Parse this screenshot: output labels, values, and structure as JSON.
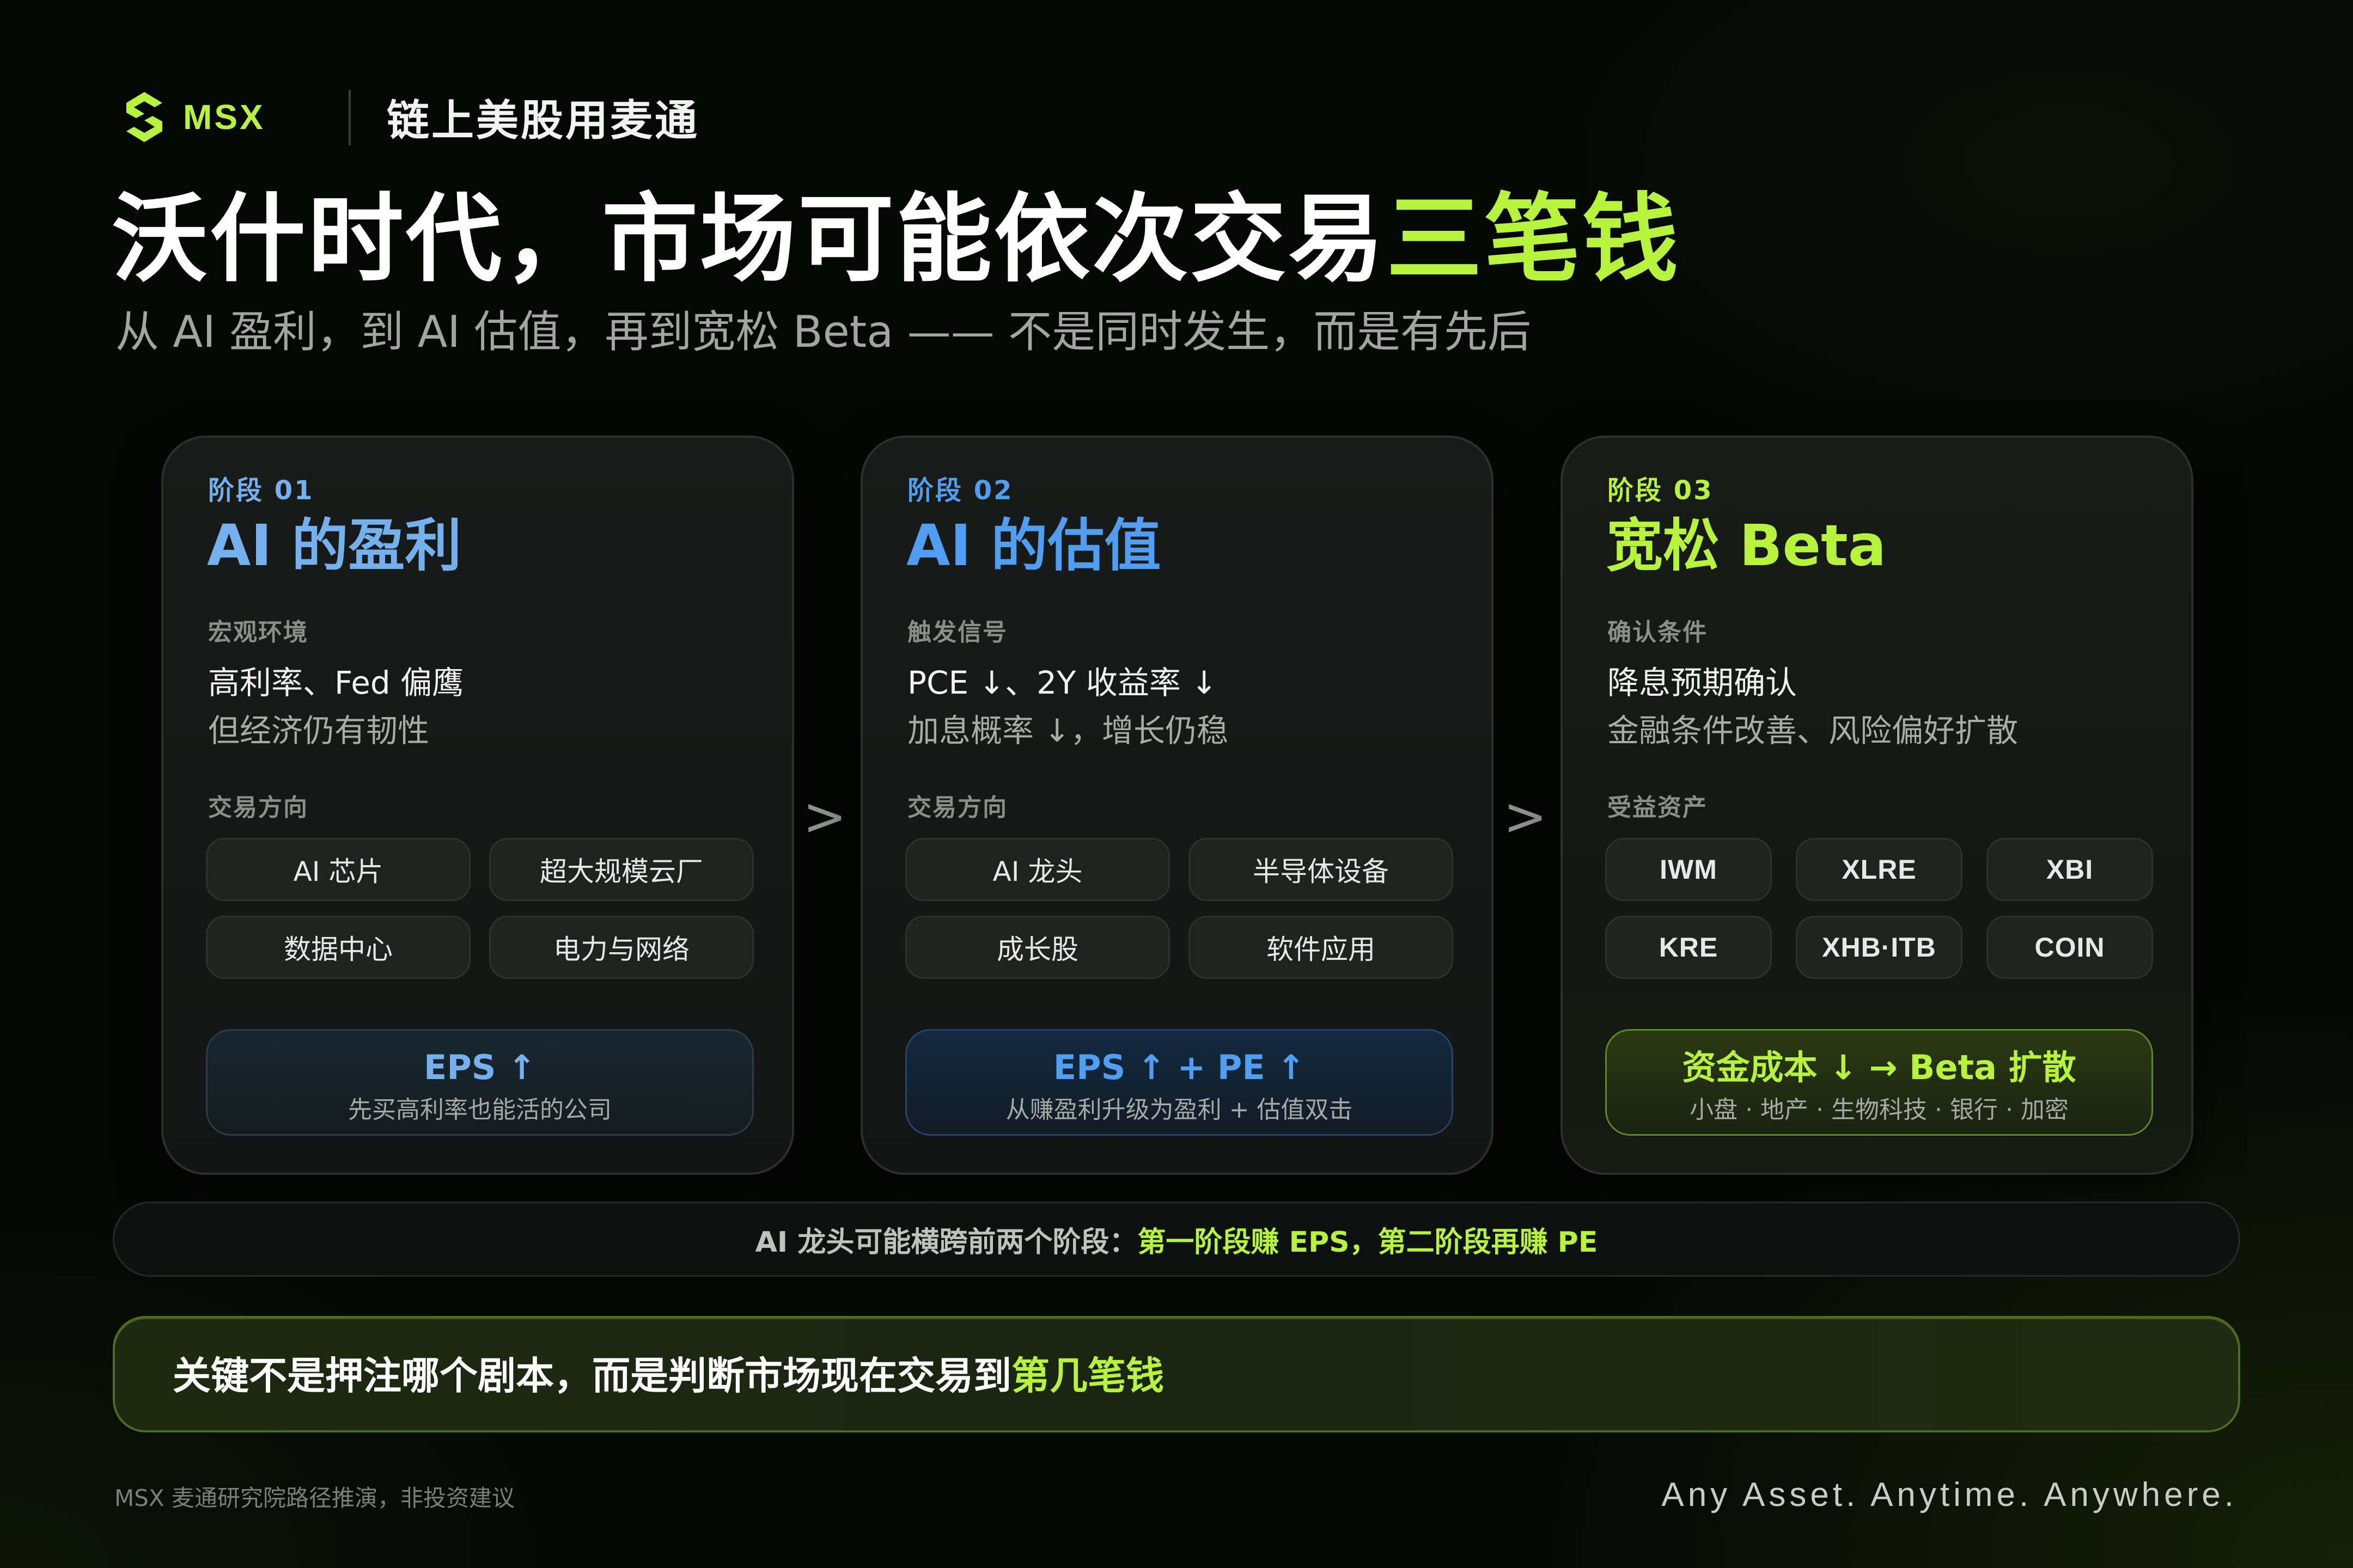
{
  "header": {
    "logo_text": "MSX",
    "tagline": "链上美股用麦通",
    "title_main": "沃什时代，市场可能依次交易",
    "title_highlight": "三笔钱",
    "subtitle": "从 AI 盈利，到 AI 估值，再到宽松 Beta —— 不是同时发生，而是有先后"
  },
  "stages": [
    {
      "label": "阶段 01",
      "title": "AI 的盈利",
      "section1_label": "宏观环境",
      "line1": "高利率、Fed 偏鹰",
      "line2": "但经济仍有韧性",
      "section2_label": "交易方向",
      "chips": [
        "AI 芯片",
        "超大规模云厂",
        "数据中心",
        "电力与网络"
      ],
      "summary_main": "EPS ↑",
      "summary_sub": "先买高利率也能活的公司"
    },
    {
      "label": "阶段 02",
      "title": "AI 的估值",
      "section1_label": "触发信号",
      "line1": "PCE ↓、2Y 收益率 ↓",
      "line2": "加息概率 ↓，增长仍稳",
      "section2_label": "交易方向",
      "chips": [
        "AI 龙头",
        "半导体设备",
        "成长股",
        "软件应用"
      ],
      "summary_main": "EPS ↑ + PE ↑",
      "summary_sub": "从赚盈利升级为盈利 + 估值双击"
    },
    {
      "label": "阶段 03",
      "title": "宽松 Beta",
      "section1_label": "确认条件",
      "line1": "降息预期确认",
      "line2": "金融条件改善、风险偏好扩散",
      "section2_label": "受益资产",
      "chips": [
        "IWM",
        "XLRE",
        "XBI",
        "KRE",
        "XHB·ITB",
        "COIN"
      ],
      "summary_main": "资金成本 ↓ → Beta 扩散",
      "summary_sub": "小盘 · 地产 · 生物科技 · 银行 · 加密"
    }
  ],
  "arrows": [
    ">",
    ">"
  ],
  "note": {
    "plain": "AI 龙头可能横跨前两个阶段：",
    "highlight": "第一阶段赚 EPS，第二阶段再赚 PE"
  },
  "key": {
    "plain": "关键不是押注哪个剧本，而是判断市场现在交易到",
    "highlight": "第几笔钱"
  },
  "footer": {
    "disclaimer": "MSX 麦通研究院路径推演，非投资建议",
    "slogan": "Any Asset. Anytime. Anywhere."
  },
  "colors": {
    "accent_green": "#b7f23c",
    "stage1_blue": "#74b0ee",
    "stage2_blue": "#4f9ef2",
    "background": "#050705"
  },
  "icons": {
    "logo": "msx-logo-icon",
    "arrow": "chevron-right-icon"
  }
}
